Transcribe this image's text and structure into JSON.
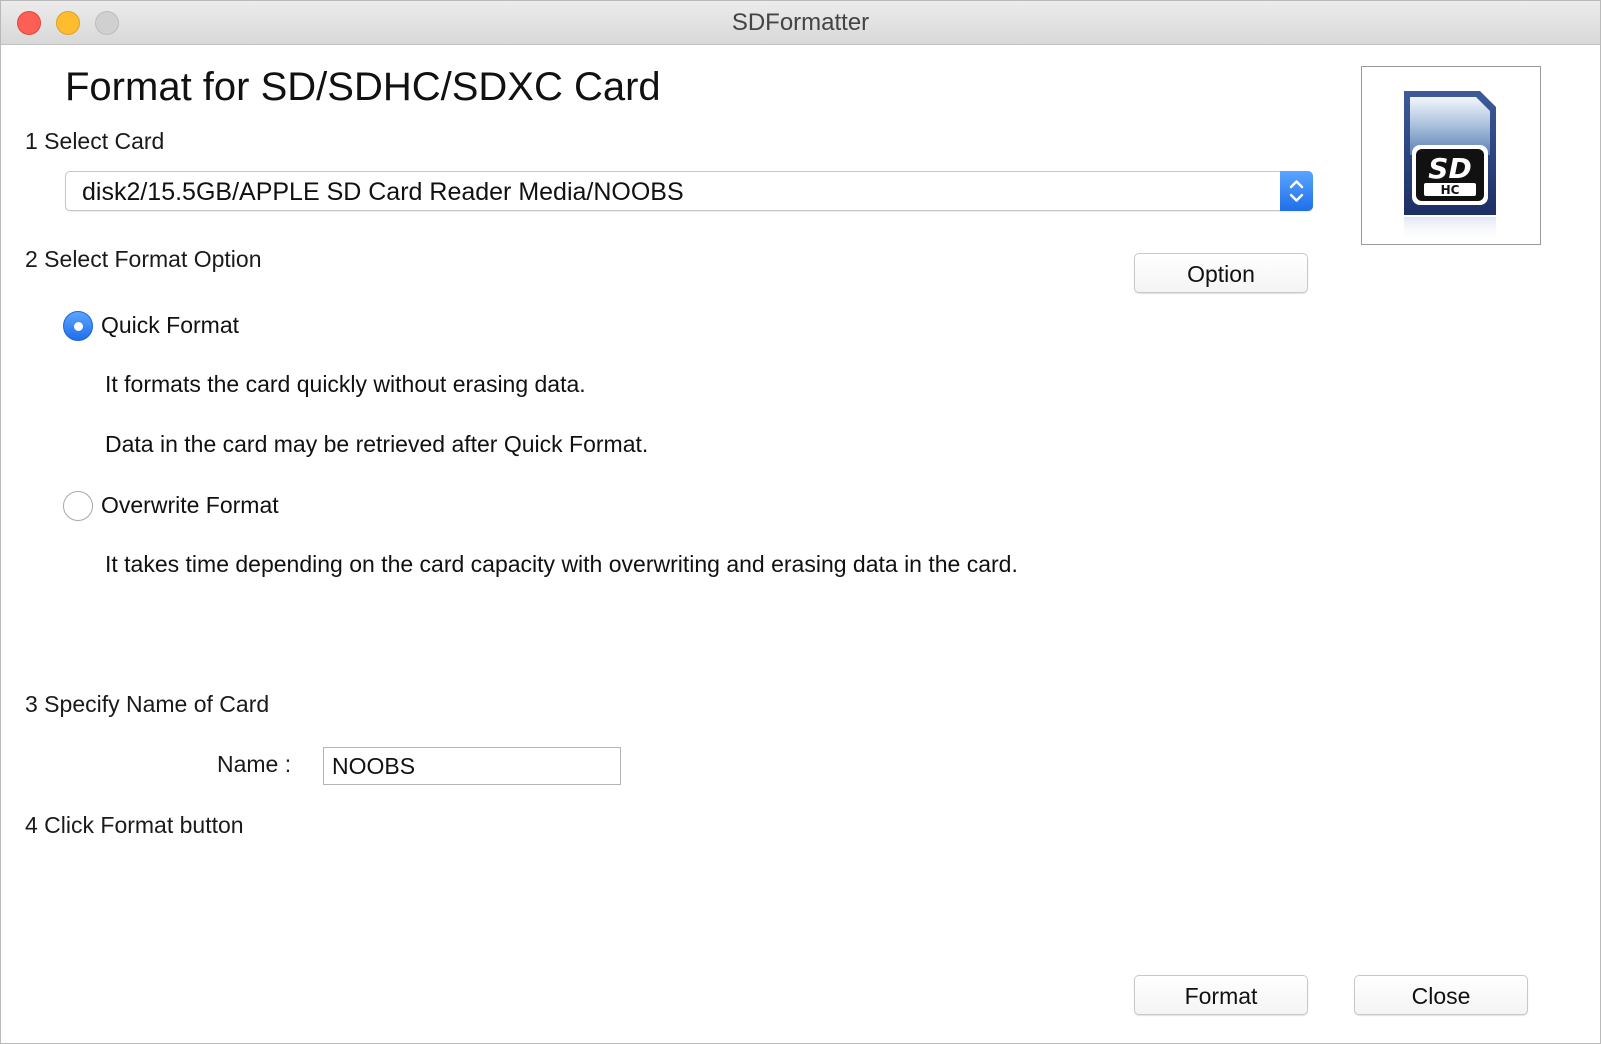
{
  "window": {
    "title": "SDFormatter"
  },
  "header": {
    "title": "Format for SD/SDHC/SDXC Card"
  },
  "step1": {
    "label": "1 Select Card",
    "selected_card": "disk2/15.5GB/APPLE SD Card Reader Media/NOOBS"
  },
  "step2": {
    "label": "2 Select Format Option",
    "option_button": "Option",
    "quick_format": {
      "label": "Quick Format",
      "selected": true,
      "description_1": "It formats the card quickly without erasing data.",
      "description_2": "Data in the card may be retrieved after Quick Format."
    },
    "overwrite_format": {
      "label": "Overwrite Format",
      "selected": false,
      "description": "It takes time depending on the card capacity with overwriting and erasing data in the card."
    }
  },
  "step3": {
    "label": "3 Specify Name of Card",
    "name_label": "Name :",
    "name_value": "NOOBS"
  },
  "step4": {
    "label": "4 Click Format button"
  },
  "footer": {
    "format_button": "Format",
    "close_button": "Close"
  },
  "icons": {
    "card_image": "sdhc-card-icon",
    "select_arrows": "chevron-up-down-icon"
  },
  "colors": {
    "accent": "#2f80ed",
    "close_light": "#fd5f57",
    "minimize_light": "#febc2e",
    "zoom_light": "#d0d0d0"
  }
}
